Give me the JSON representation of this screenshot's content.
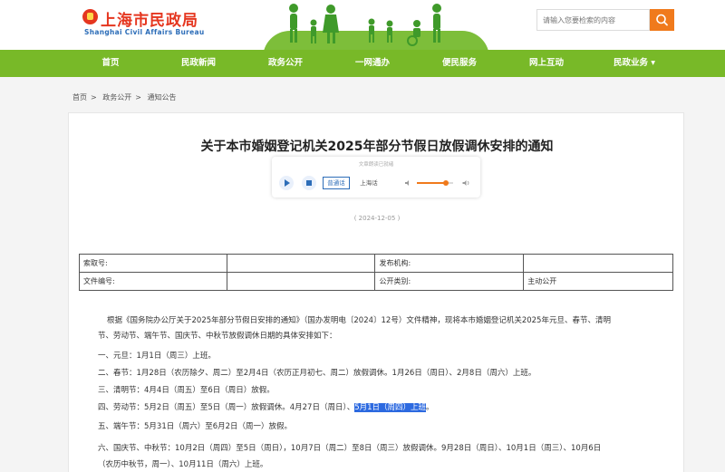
{
  "header": {
    "logo_cn": "上海市民政局",
    "logo_en": "Shanghai  Civil  Affairs  Bureau",
    "search_placeholder": "请输入您要检索的内容"
  },
  "nav": {
    "items": [
      "首页",
      "民政新闻",
      "政务公开",
      "一网通办",
      "便民服务",
      "网上互动",
      "民政业务 ▾"
    ]
  },
  "breadcrumb": [
    "首页",
    "政务公开",
    "通知公告"
  ],
  "breadcrumb_sep": ">",
  "article": {
    "title": "关于本市婚姻登记机关2025年部分节假日放假调休安排的通知",
    "date": "( 2024-12-05 )"
  },
  "player": {
    "hint": "文章朗读已就绪",
    "lang_mandarin": "普通话",
    "lang_shanghai": "上海话",
    "volume": 0.8
  },
  "info_table": {
    "rows": [
      [
        "索取号:",
        "",
        "发布机构:",
        ""
      ],
      [
        "文件编号:",
        "",
        "公开类别:",
        "主动公开"
      ]
    ]
  },
  "body": {
    "intro_1": "根据《国务院办公厅关于2025年部分节假日安排的通知》（国办发明电〔2024〕12号）文件精神，现将本市婚姻登记机关2025年元旦、春节、清明",
    "intro_2": "节、劳动节、端午节、国庆节、中秋节放假调休日期的具体安排如下：",
    "item_1": "一、元旦：1月1日（周三）上班。",
    "item_2": "二、春节：1月28日（农历除夕、周二）至2月4日（农历正月初七、周二）放假调休。1月26日（周日）、2月8日（周六）上班。",
    "item_3": "三、清明节：4月4日（周五）至6日（周日）放假。",
    "item_4_pre": "四、劳动节：5月2日（周五）至5日（周一）放假调休。4月27日（周日）、",
    "item_4_hl": "5月1日（周四）上班",
    "item_4_post": "。",
    "item_5": "五、端午节：5月31日（周六）至6月2日（周一）放假。",
    "item_6_1": "六、国庆节、中秋节：10月2日（周四）至5日（周日），10月7日（周二）至8日（周三）放假调休。9月28日（周日）、10月1日（周三）、10月6日",
    "item_6_2": "（农历中秋节，周一）、10月11日（周六）上班。"
  }
}
